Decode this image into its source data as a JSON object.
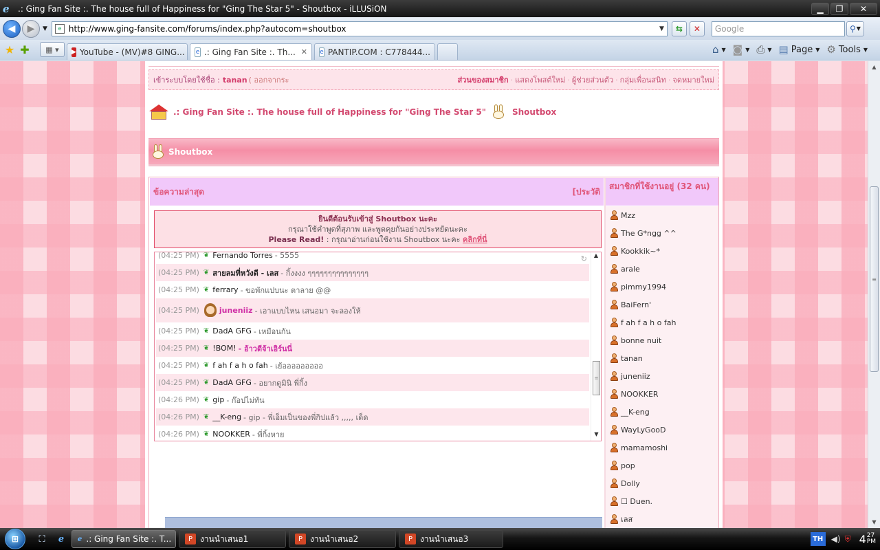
{
  "window": {
    "title": ".: Ging Fan Site :. The house full of Happiness for \"Ging The Star 5\" - Shoutbox - iLLUSiON"
  },
  "address_bar": {
    "url": "http://www.ging-fansite.com/forums/index.php?autocom=shoutbox",
    "search_placeholder": "Google"
  },
  "tabs": [
    {
      "label": "YouTube - (MV)#8 GING...",
      "icon": "youtube-icon",
      "active": false
    },
    {
      "label": ".: Ging Fan Site :. Th...",
      "icon": "ie-page-icon",
      "active": true
    },
    {
      "label": "PANTIP.COM : C778444...",
      "icon": "ie-page-icon",
      "active": false
    }
  ],
  "command_bar": {
    "page_label": "Page",
    "tools_label": "Tools"
  },
  "userbar": {
    "logged_in_prefix": "เข้าระบบโดยใช้ชื่อ :",
    "username": "tanan",
    "logout": "( ออกจากระ",
    "my_controls": "ส่วนของสมาชิก",
    "view_new_posts": "แสดงโพสต์ใหม่",
    "my_assistant": "ผู้ช่วยส่วนตัว",
    "my_friends": "กลุ่มเพื่อนสนิท",
    "messenger": "จดหมายใหม่"
  },
  "breadcrumb": {
    "site": ".: Ging Fan Site :. The house full of Happiness for \"Ging The Star 5\"",
    "current": "Shoutbox"
  },
  "shoutbox": {
    "header_title": "Shoutbox",
    "latest_title": "ข้อความล่าสุด",
    "history_link": "[ประวัติ",
    "online_title": "สมาชิกที่ใช้งานอยู่ (32 คน)",
    "welcome_line1": "ยินดีต้อนรับเข้าสู่ Shoutbox นะคะ",
    "welcome_line2": "กรุณาใช้คำพูดที่สุภาพ และพูดคุยกันอย่างประหยัดนะคะ",
    "welcome_line3_bold": "Please Read!",
    "welcome_line3_text": ": กรุณาอ่านก่อนใช้งาน Shoutbox นะคะ",
    "welcome_line3_link": "คลิกที่นี่",
    "messages": [
      {
        "time": "(04:25 PM)",
        "name": "Fernando Torres",
        "text": "- 5555",
        "style": "normal"
      },
      {
        "time": "(04:25 PM)",
        "name": "สายลมที่หวังดี - เลส",
        "text": "- กิ้งงงง ๆๆๆๆๆๆๆๆๆๆๆๆๆๆๆ",
        "style": "bold"
      },
      {
        "time": "(04:25 PM)",
        "name": "ferrary",
        "text": "- ขอพักแปบนะ ตาลาย @@",
        "style": "normal"
      },
      {
        "time": "(04:25 PM)",
        "name": "juneniiz",
        "text": "- เอาแบบไหน เสนอมา จะลองให้",
        "style": "avatar"
      },
      {
        "time": "(04:25 PM)",
        "name": "DadA GFG",
        "text": "- เหมือนกัน",
        "style": "normal"
      },
      {
        "time": "(04:25 PM)",
        "name": "!BOM!",
        "text": "- อ้าวดีจ้าเอิร์นนี่",
        "style": "pinktext"
      },
      {
        "time": "(04:25 PM)",
        "name": "f ah f a h o fah",
        "text": "- เย้อออออออออ",
        "style": "normal"
      },
      {
        "time": "(04:25 PM)",
        "name": "DadA GFG",
        "text": "- อยากดูมินิ พี่กิ้ง",
        "style": "normal"
      },
      {
        "time": "(04:26 PM)",
        "name": "gip",
        "text": "- ก๊อปไม่ทัน",
        "style": "normal"
      },
      {
        "time": "(04:26 PM)",
        "name": "__K-eng",
        "text": "- gip - พี่เอ็มเป็นของพี่กิปแล้ว ,,,,, เด็ด",
        "style": "normal"
      },
      {
        "time": "(04:26 PM)",
        "name": "NOOKKER",
        "text": "- พี่กิ้งหาย",
        "style": "normal"
      }
    ],
    "members": [
      "Mzz",
      "The G*ngg ^^",
      "Kookkik~*",
      "arale",
      "pimmy1994",
      "BaiFern'",
      "f ah f a h o fah",
      "bonne nuit",
      "tanan",
      "juneniiz",
      "NOOKKER",
      "__K-eng",
      "WayLyGooD",
      "mamamoshi",
      "pop",
      "Dolly",
      "☐ Duen.",
      "เลส"
    ]
  },
  "taskbar": {
    "buttons": [
      {
        "label": ".: Ging Fan Site :. T...",
        "icon": "ie-icon",
        "active": true
      },
      {
        "label": "งานนำเสนอ1",
        "icon": "powerpoint-icon",
        "active": false
      },
      {
        "label": "งานนำเสนอ2",
        "icon": "powerpoint-icon",
        "active": false
      },
      {
        "label": "งานนำเสนอ3",
        "icon": "powerpoint-icon",
        "active": false
      }
    ],
    "language": "TH",
    "clock_hour": "4",
    "clock_minute": "27",
    "clock_ampm": "PM"
  }
}
